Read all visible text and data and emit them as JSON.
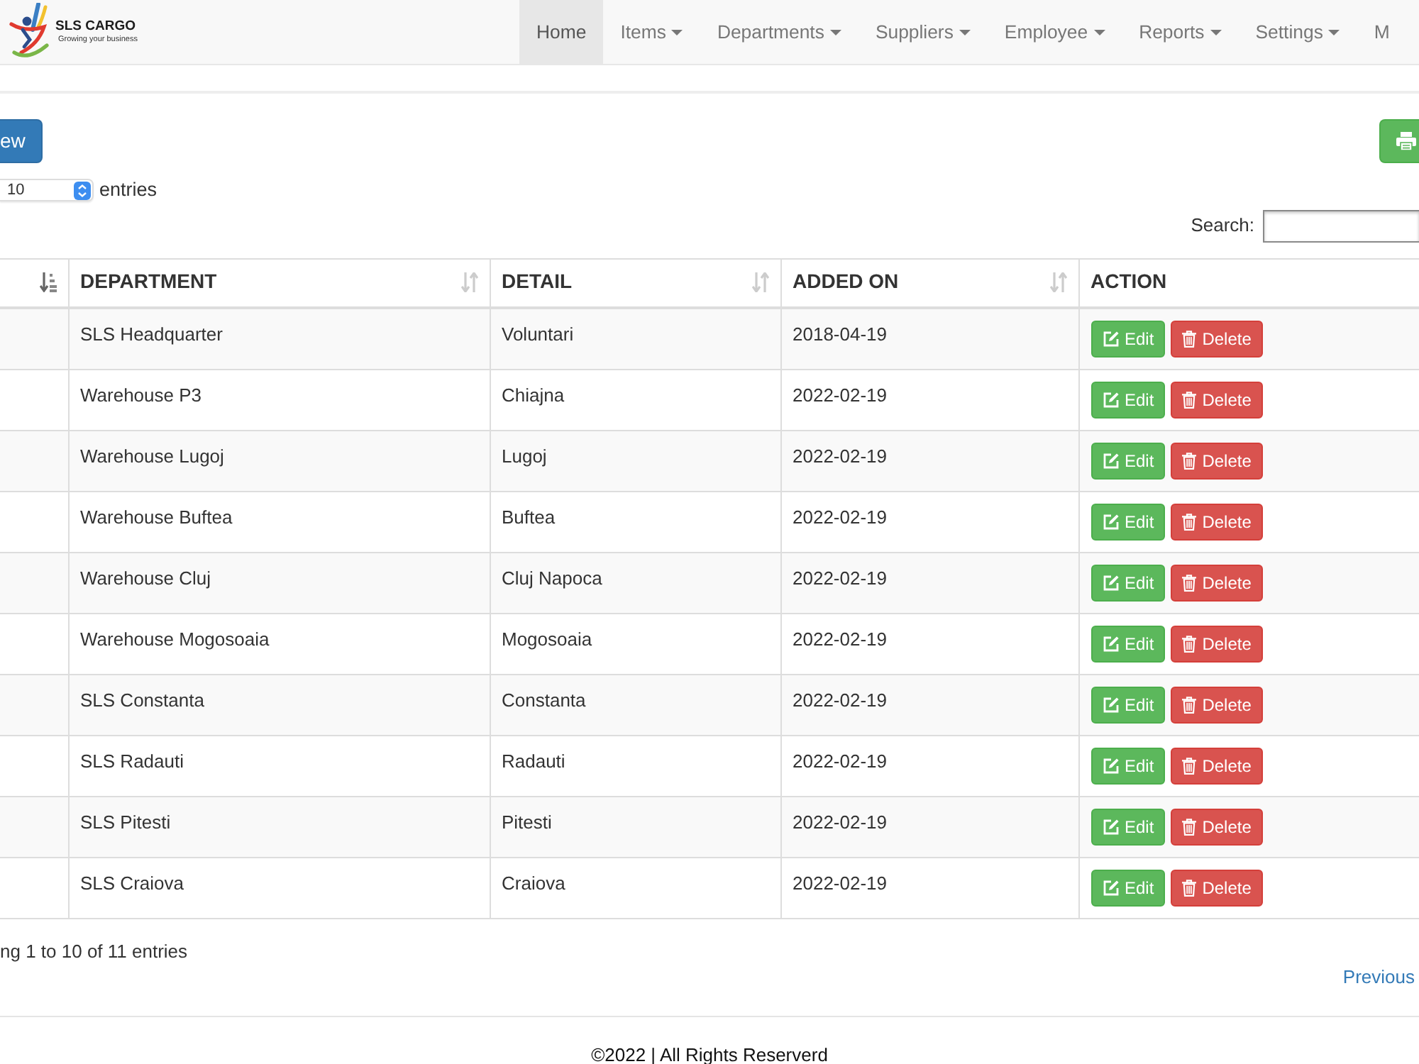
{
  "navbar": {
    "brand": {
      "name": "SLS CARGO",
      "tagline": "Growing your business"
    },
    "items": [
      {
        "label": "Home",
        "dropdown": false,
        "selected": true
      },
      {
        "label": "Items",
        "dropdown": true,
        "selected": false
      },
      {
        "label": "Departments",
        "dropdown": true,
        "selected": false
      },
      {
        "label": "Suppliers",
        "dropdown": true,
        "selected": false
      },
      {
        "label": "Employee",
        "dropdown": true,
        "selected": false
      },
      {
        "label": "Reports",
        "dropdown": true,
        "selected": false
      },
      {
        "label": "Settings",
        "dropdown": true,
        "selected": false
      },
      {
        "label": "M",
        "dropdown": false,
        "selected": false
      }
    ]
  },
  "toolbar": {
    "add_button": "ew"
  },
  "length_menu": {
    "value": "10",
    "label": "entries"
  },
  "search": {
    "label": "Search:"
  },
  "table": {
    "columns": [
      {
        "sortable": true,
        "sorted": true
      },
      {
        "label": "DEPARTMENT",
        "sortable": true,
        "sorted": false
      },
      {
        "label": "DETAIL",
        "sortable": true,
        "sorted": false
      },
      {
        "label": "ADDED ON",
        "sortable": true,
        "sorted": false
      },
      {
        "label": "ACTION",
        "sortable": false
      }
    ],
    "rows": [
      {
        "department": "SLS Headquarter",
        "detail": "Voluntari",
        "added_on": "2018-04-19",
        "actions": [
          {
            "kind": "edit",
            "label": "Edit"
          },
          {
            "kind": "delete",
            "label": "Delete"
          }
        ]
      },
      {
        "department": "Warehouse P3",
        "detail": "Chiajna",
        "added_on": "2022-02-19",
        "actions": [
          {
            "kind": "edit",
            "label": "Edit"
          },
          {
            "kind": "delete",
            "label": "Delete"
          }
        ]
      },
      {
        "department": "Warehouse Lugoj",
        "detail": "Lugoj",
        "added_on": "2022-02-19",
        "actions": [
          {
            "kind": "edit",
            "label": "Edit"
          },
          {
            "kind": "delete",
            "label": "Delete"
          }
        ]
      },
      {
        "department": "Warehouse Buftea",
        "detail": "Buftea",
        "added_on": "2022-02-19",
        "actions": [
          {
            "kind": "edit",
            "label": "Edit"
          },
          {
            "kind": "delete",
            "label": "Delete"
          }
        ]
      },
      {
        "department": "Warehouse Cluj",
        "detail": "Cluj Napoca",
        "added_on": "2022-02-19",
        "actions": [
          {
            "kind": "edit",
            "label": "Edit"
          },
          {
            "kind": "delete",
            "label": "Delete"
          }
        ]
      },
      {
        "department": "Warehouse Mogosoaia",
        "detail": "Mogosoaia",
        "added_on": "2022-02-19",
        "actions": [
          {
            "kind": "edit",
            "label": "Edit"
          },
          {
            "kind": "delete",
            "label": "Delete"
          }
        ]
      },
      {
        "department": "SLS Constanta",
        "detail": "Constanta",
        "added_on": "2022-02-19",
        "actions": [
          {
            "kind": "edit",
            "label": "Edit"
          },
          {
            "kind": "delete",
            "label": "Delete"
          }
        ]
      },
      {
        "department": "SLS Radauti",
        "detail": "Radauti",
        "added_on": "2022-02-19",
        "actions": [
          {
            "kind": "edit",
            "label": "Edit"
          },
          {
            "kind": "delete",
            "label": "Delete"
          }
        ]
      },
      {
        "department": "SLS Pitesti",
        "detail": "Pitesti",
        "added_on": "2022-02-19",
        "actions": [
          {
            "kind": "edit",
            "label": "Edit"
          },
          {
            "kind": "delete",
            "label": "Delete"
          }
        ]
      },
      {
        "department": "SLS Craiova",
        "detail": "Craiova",
        "added_on": "2022-02-19",
        "actions": [
          {
            "kind": "edit",
            "label": "Edit"
          },
          {
            "kind": "delete",
            "label": "Delete"
          }
        ]
      }
    ]
  },
  "info": "ng 1 to 10 of 11 entries",
  "pagination": {
    "previous": "Previous"
  },
  "footer": "©2022 | All Rights Reserverd"
}
